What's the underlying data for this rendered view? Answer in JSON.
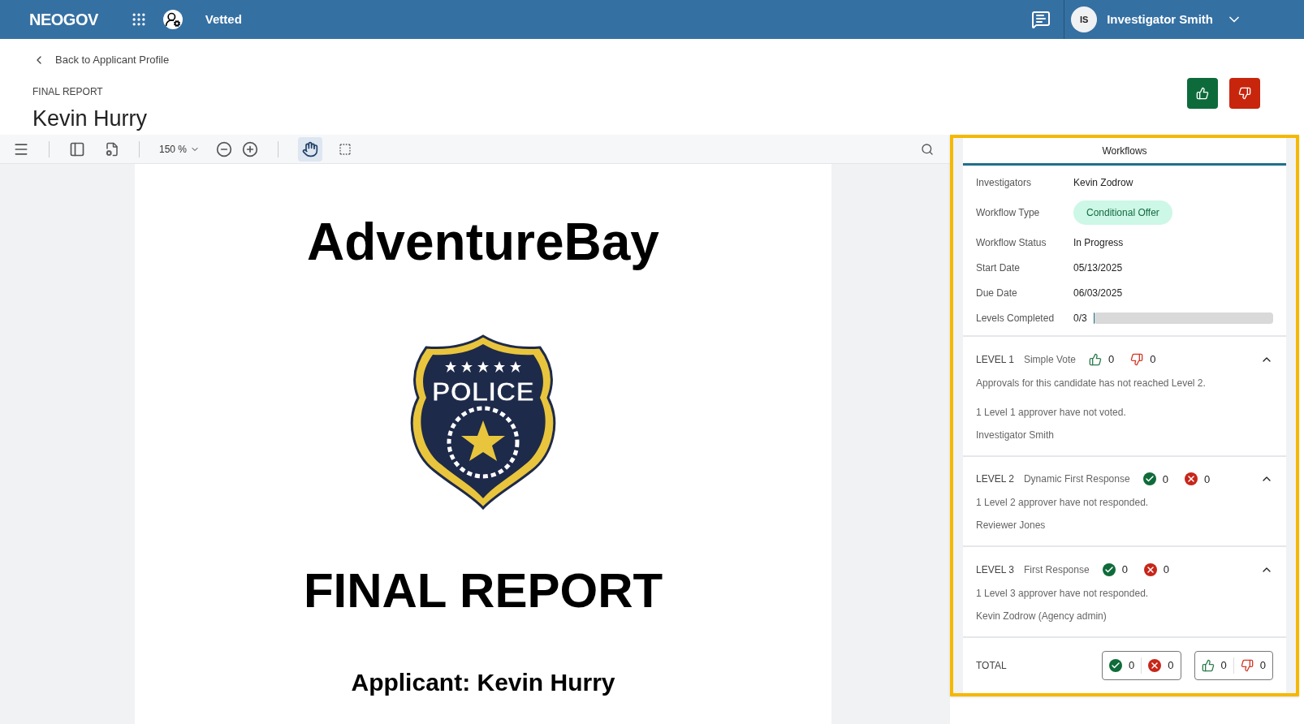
{
  "header": {
    "brand": "NEOGOV",
    "app": "Vetted",
    "user": {
      "initials": "IS",
      "name": "Investigator Smith"
    }
  },
  "page": {
    "back_link": "Back to Applicant Profile",
    "eyebrow": "FINAL REPORT",
    "title": "Kevin Hurry"
  },
  "viewer": {
    "toolbar": {
      "zoom": "150 %",
      "hand_tool_selected": true
    },
    "document": {
      "company": "AdventureBay",
      "badge_text": "POLICE",
      "heading": "FINAL REPORT",
      "applicant": "Applicant: Kevin Hurry"
    }
  },
  "workflow_panel": {
    "tab": "Workflows",
    "details": [
      {
        "label": "Investigators",
        "value": "Kevin Zodrow",
        "kind": "text"
      },
      {
        "label": "Workflow Type",
        "value": "Conditional Offer",
        "kind": "pill"
      },
      {
        "label": "Workflow Status",
        "value": "In Progress",
        "kind": "text"
      },
      {
        "label": "Start Date",
        "value": "05/13/2025",
        "kind": "text"
      },
      {
        "label": "Due Date",
        "value": "06/03/2025",
        "kind": "text"
      },
      {
        "label": "Levels Completed",
        "value": "0/3",
        "kind": "progress",
        "level": 0
      }
    ],
    "levels": [
      {
        "title": "LEVEL 1",
        "type": "Simple Vote",
        "kind": "vote",
        "yes": "0",
        "no": "0",
        "expanded": true,
        "lines": [
          "Approvals for this candidate has not reached Level 2.",
          "1 Level 1 approver have not voted.",
          "Investigator Smith"
        ]
      },
      {
        "title": "LEVEL 2",
        "type": "Dynamic First Response",
        "kind": "response",
        "yes": "0",
        "no": "0",
        "expanded": true,
        "lines": [
          "1 Level 2 approver have not responded.",
          "Reviewer Jones"
        ]
      },
      {
        "title": "LEVEL 3",
        "type": "First Response",
        "kind": "response",
        "yes": "0",
        "no": "0",
        "expanded": true,
        "lines": [
          "1 Level 3 approver have not responded.",
          "Kevin Zodrow (Agency admin)"
        ]
      }
    ],
    "total": {
      "label": "TOTAL",
      "groups": [
        {
          "kind": "response",
          "yes": "0",
          "no": "0"
        },
        {
          "kind": "vote",
          "yes": "0",
          "no": "0"
        }
      ]
    }
  }
}
